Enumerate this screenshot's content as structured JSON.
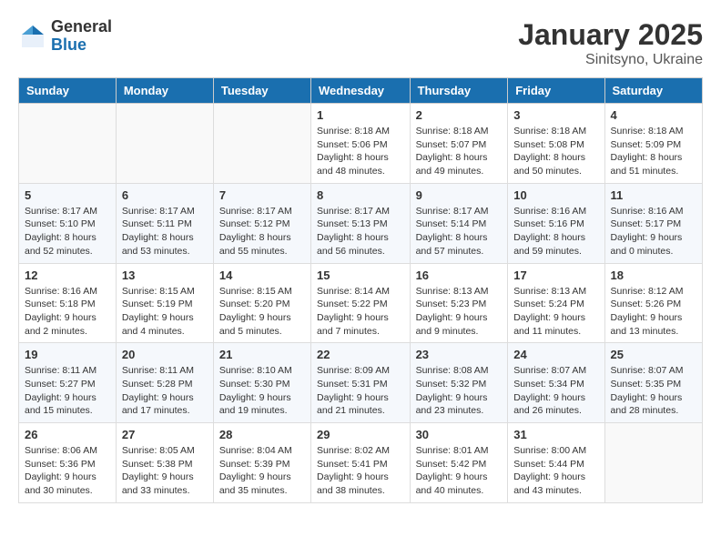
{
  "logo": {
    "general": "General",
    "blue": "Blue"
  },
  "title": "January 2025",
  "subtitle": "Sinitsyno, Ukraine",
  "days_header": [
    "Sunday",
    "Monday",
    "Tuesday",
    "Wednesday",
    "Thursday",
    "Friday",
    "Saturday"
  ],
  "weeks": [
    [
      {
        "day": "",
        "info": ""
      },
      {
        "day": "",
        "info": ""
      },
      {
        "day": "",
        "info": ""
      },
      {
        "day": "1",
        "info": "Sunrise: 8:18 AM\nSunset: 5:06 PM\nDaylight: 8 hours\nand 48 minutes."
      },
      {
        "day": "2",
        "info": "Sunrise: 8:18 AM\nSunset: 5:07 PM\nDaylight: 8 hours\nand 49 minutes."
      },
      {
        "day": "3",
        "info": "Sunrise: 8:18 AM\nSunset: 5:08 PM\nDaylight: 8 hours\nand 50 minutes."
      },
      {
        "day": "4",
        "info": "Sunrise: 8:18 AM\nSunset: 5:09 PM\nDaylight: 8 hours\nand 51 minutes."
      }
    ],
    [
      {
        "day": "5",
        "info": "Sunrise: 8:17 AM\nSunset: 5:10 PM\nDaylight: 8 hours\nand 52 minutes."
      },
      {
        "day": "6",
        "info": "Sunrise: 8:17 AM\nSunset: 5:11 PM\nDaylight: 8 hours\nand 53 minutes."
      },
      {
        "day": "7",
        "info": "Sunrise: 8:17 AM\nSunset: 5:12 PM\nDaylight: 8 hours\nand 55 minutes."
      },
      {
        "day": "8",
        "info": "Sunrise: 8:17 AM\nSunset: 5:13 PM\nDaylight: 8 hours\nand 56 minutes."
      },
      {
        "day": "9",
        "info": "Sunrise: 8:17 AM\nSunset: 5:14 PM\nDaylight: 8 hours\nand 57 minutes."
      },
      {
        "day": "10",
        "info": "Sunrise: 8:16 AM\nSunset: 5:16 PM\nDaylight: 8 hours\nand 59 minutes."
      },
      {
        "day": "11",
        "info": "Sunrise: 8:16 AM\nSunset: 5:17 PM\nDaylight: 9 hours\nand 0 minutes."
      }
    ],
    [
      {
        "day": "12",
        "info": "Sunrise: 8:16 AM\nSunset: 5:18 PM\nDaylight: 9 hours\nand 2 minutes."
      },
      {
        "day": "13",
        "info": "Sunrise: 8:15 AM\nSunset: 5:19 PM\nDaylight: 9 hours\nand 4 minutes."
      },
      {
        "day": "14",
        "info": "Sunrise: 8:15 AM\nSunset: 5:20 PM\nDaylight: 9 hours\nand 5 minutes."
      },
      {
        "day": "15",
        "info": "Sunrise: 8:14 AM\nSunset: 5:22 PM\nDaylight: 9 hours\nand 7 minutes."
      },
      {
        "day": "16",
        "info": "Sunrise: 8:13 AM\nSunset: 5:23 PM\nDaylight: 9 hours\nand 9 minutes."
      },
      {
        "day": "17",
        "info": "Sunrise: 8:13 AM\nSunset: 5:24 PM\nDaylight: 9 hours\nand 11 minutes."
      },
      {
        "day": "18",
        "info": "Sunrise: 8:12 AM\nSunset: 5:26 PM\nDaylight: 9 hours\nand 13 minutes."
      }
    ],
    [
      {
        "day": "19",
        "info": "Sunrise: 8:11 AM\nSunset: 5:27 PM\nDaylight: 9 hours\nand 15 minutes."
      },
      {
        "day": "20",
        "info": "Sunrise: 8:11 AM\nSunset: 5:28 PM\nDaylight: 9 hours\nand 17 minutes."
      },
      {
        "day": "21",
        "info": "Sunrise: 8:10 AM\nSunset: 5:30 PM\nDaylight: 9 hours\nand 19 minutes."
      },
      {
        "day": "22",
        "info": "Sunrise: 8:09 AM\nSunset: 5:31 PM\nDaylight: 9 hours\nand 21 minutes."
      },
      {
        "day": "23",
        "info": "Sunrise: 8:08 AM\nSunset: 5:32 PM\nDaylight: 9 hours\nand 23 minutes."
      },
      {
        "day": "24",
        "info": "Sunrise: 8:07 AM\nSunset: 5:34 PM\nDaylight: 9 hours\nand 26 minutes."
      },
      {
        "day": "25",
        "info": "Sunrise: 8:07 AM\nSunset: 5:35 PM\nDaylight: 9 hours\nand 28 minutes."
      }
    ],
    [
      {
        "day": "26",
        "info": "Sunrise: 8:06 AM\nSunset: 5:36 PM\nDaylight: 9 hours\nand 30 minutes."
      },
      {
        "day": "27",
        "info": "Sunrise: 8:05 AM\nSunset: 5:38 PM\nDaylight: 9 hours\nand 33 minutes."
      },
      {
        "day": "28",
        "info": "Sunrise: 8:04 AM\nSunset: 5:39 PM\nDaylight: 9 hours\nand 35 minutes."
      },
      {
        "day": "29",
        "info": "Sunrise: 8:02 AM\nSunset: 5:41 PM\nDaylight: 9 hours\nand 38 minutes."
      },
      {
        "day": "30",
        "info": "Sunrise: 8:01 AM\nSunset: 5:42 PM\nDaylight: 9 hours\nand 40 minutes."
      },
      {
        "day": "31",
        "info": "Sunrise: 8:00 AM\nSunset: 5:44 PM\nDaylight: 9 hours\nand 43 minutes."
      },
      {
        "day": "",
        "info": ""
      }
    ]
  ]
}
